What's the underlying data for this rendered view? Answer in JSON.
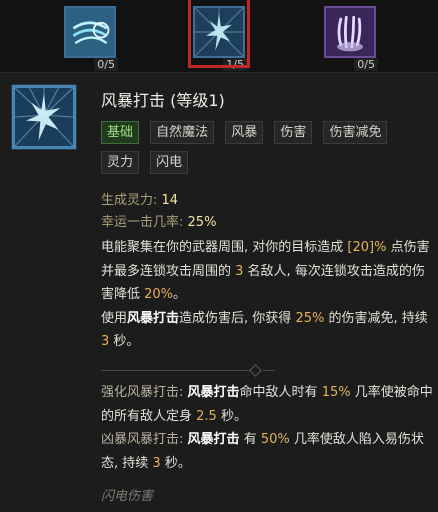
{
  "skill_bar": {
    "slots": [
      {
        "name": "wind-shear",
        "count": "0/5"
      },
      {
        "name": "storm-strike",
        "count": "1/5",
        "selected": true
      },
      {
        "name": "claw",
        "count": "0/5"
      }
    ]
  },
  "tooltip": {
    "title": "风暴打击 (等级1)",
    "tags": [
      "基础",
      "自然魔法",
      "风暴",
      "伤害",
      "伤害减免",
      "灵力",
      "闪电"
    ],
    "stats": {
      "spirit_label": "生成灵力:",
      "spirit_value": "14",
      "lucky_label": "幸运一击几率:",
      "lucky_value": "25%"
    },
    "desc": {
      "p1_a": "电能聚集在你的武器周围, 对你的目标造成 ",
      "p1_dmg": "[20]%",
      "p1_b": " 点伤害并最多连锁攻击周围的 ",
      "p1_targets": "3",
      "p1_c": " 名敌人, 每次连锁攻击造成的伤害降低 ",
      "p1_reduction": "20%",
      "p1_d": "。",
      "p2_a": "使用",
      "p2_skill": "风暴打击",
      "p2_b": "造成伤害后, 你获得 ",
      "p2_dr": "25%",
      "p2_c": " 的伤害减免, 持续 ",
      "p2_duration": "3",
      "p2_d": " 秒。"
    },
    "enhancements": {
      "e1_label": "强化风暴打击:",
      "e1_skill": "风暴打击",
      "e1_a": "命中敌人时有 ",
      "e1_chance": "15%",
      "e1_b": " 几率使被命中的所有敌人定身 ",
      "e1_dur": "2.5",
      "e1_c": " 秒。",
      "e2_label": "凶暴风暴打击:",
      "e2_skill": "风暴打击",
      "e2_a": "有 ",
      "e2_chance": "50%",
      "e2_b": " 几率使敌人陷入易伤状态, 持续 ",
      "e2_dur": "3",
      "e2_c": " 秒。"
    },
    "footer": "闪电伤害"
  },
  "colors": {
    "tag_primary": "#9fe07f",
    "highlight": "#e3b25a",
    "selected_border": "#c0282a"
  }
}
